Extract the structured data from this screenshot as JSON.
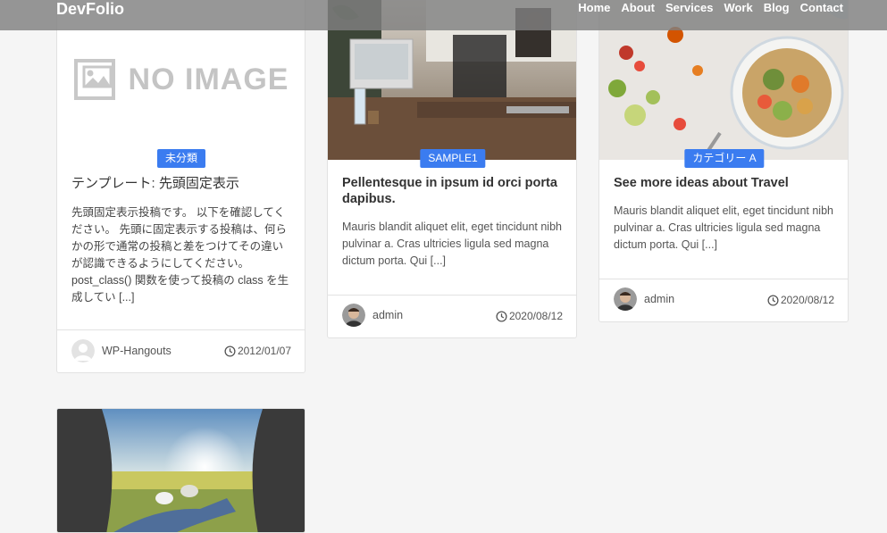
{
  "header": {
    "brand": "DevFolio",
    "nav": [
      "Home",
      "About",
      "Services",
      "Work",
      "Blog",
      "Contact"
    ]
  },
  "posts": [
    {
      "category": "未分類",
      "image_text": "NO IMAGE",
      "title": "テンプレート: 先頭固定表示",
      "excerpt": "先頭固定表示投稿です。 以下を確認してください。 先頭に固定表示する投稿は、何らかの形で通常の投稿と差をつけてその違いが認識できるようにしてください。 post_class() 関数を使って投稿の class を生成してい [...]",
      "author": "WP-Hangouts",
      "date": "2012/01/07"
    },
    {
      "category": "SAMPLE1",
      "title": "Pellentesque in ipsum id orci porta dapibus.",
      "excerpt": "Mauris blandit aliquet elit, eget tincidunt nibh pulvinar a. Cras ultricies ligula sed magna dictum porta. Qui [...]",
      "author": "admin",
      "date": "2020/08/12"
    },
    {
      "category": "カテゴリー A",
      "title": "See more ideas about Travel",
      "excerpt": "Mauris blandit aliquet elit, eget tincidunt nibh pulvinar a. Cras ultricies ligula sed magna dictum porta. Qui [...]",
      "author": "admin",
      "date": "2020/08/12"
    }
  ],
  "colors": {
    "accent": "#3b7cf0",
    "header_bg": "#808080",
    "page_bg": "#f5f5f5"
  }
}
